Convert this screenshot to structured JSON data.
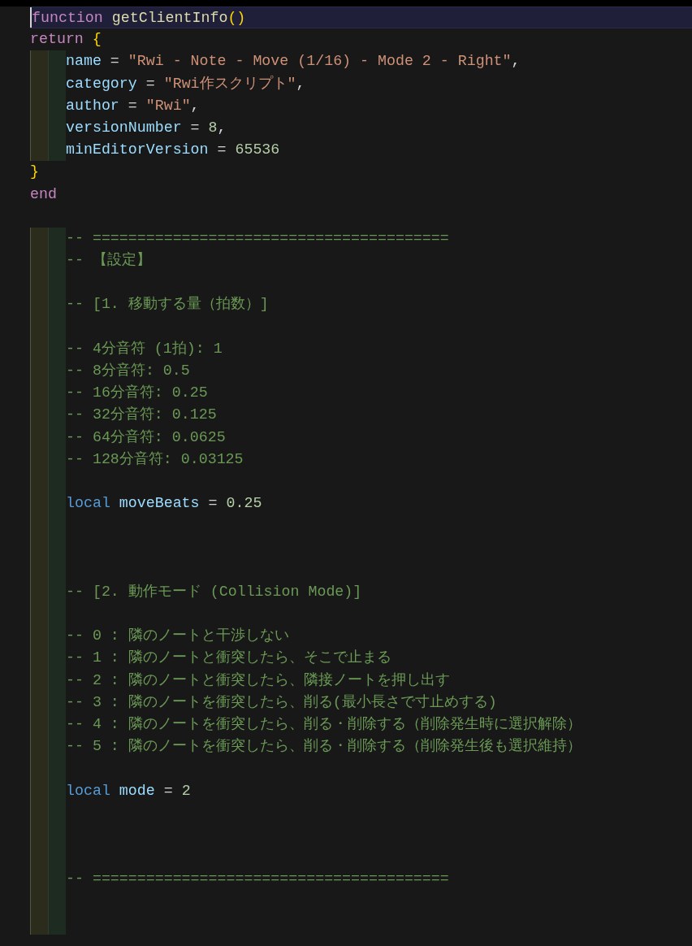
{
  "lines": [
    {
      "guides": false,
      "current": true,
      "tokens": [
        {
          "kind": "keyword",
          "text": "function "
        },
        {
          "kind": "function",
          "text": "getClientInfo"
        },
        {
          "kind": "brace",
          "text": "()"
        }
      ]
    },
    {
      "guides": false,
      "current": false,
      "tokens": [
        {
          "kind": "keyword",
          "text": "return "
        },
        {
          "kind": "brace",
          "text": "{"
        }
      ]
    },
    {
      "guides": true,
      "current": false,
      "tokens": [
        {
          "kind": "property",
          "text": "name "
        },
        {
          "kind": "operator",
          "text": "= "
        },
        {
          "kind": "string",
          "text": "\"Rwi - Note - Move (1/16) - Mode 2 - Right\""
        },
        {
          "kind": "operator",
          "text": ","
        }
      ]
    },
    {
      "guides": true,
      "current": false,
      "tokens": [
        {
          "kind": "property",
          "text": "category "
        },
        {
          "kind": "operator",
          "text": "= "
        },
        {
          "kind": "string",
          "text": "\"Rwi作スクリプト\""
        },
        {
          "kind": "operator",
          "text": ","
        }
      ]
    },
    {
      "guides": true,
      "current": false,
      "tokens": [
        {
          "kind": "property",
          "text": "author "
        },
        {
          "kind": "operator",
          "text": "= "
        },
        {
          "kind": "string",
          "text": "\"Rwi\""
        },
        {
          "kind": "operator",
          "text": ","
        }
      ]
    },
    {
      "guides": true,
      "current": false,
      "tokens": [
        {
          "kind": "property",
          "text": "versionNumber "
        },
        {
          "kind": "operator",
          "text": "= "
        },
        {
          "kind": "number",
          "text": "8"
        },
        {
          "kind": "operator",
          "text": ","
        }
      ]
    },
    {
      "guides": true,
      "current": false,
      "tokens": [
        {
          "kind": "property",
          "text": "minEditorVersion "
        },
        {
          "kind": "operator",
          "text": "= "
        },
        {
          "kind": "number",
          "text": "65536"
        }
      ]
    },
    {
      "guides": false,
      "current": false,
      "tokens": [
        {
          "kind": "brace",
          "text": "}"
        }
      ]
    },
    {
      "guides": false,
      "current": false,
      "tokens": [
        {
          "kind": "keyword",
          "text": "end"
        }
      ]
    },
    {
      "guides": false,
      "current": false
    },
    {
      "guides": true,
      "current": false,
      "tokens": [
        {
          "kind": "comment",
          "text": "-- ========================================"
        }
      ]
    },
    {
      "guides": true,
      "current": false,
      "tokens": [
        {
          "kind": "comment",
          "text": "-- 【設定】"
        }
      ]
    },
    {
      "guides": true,
      "current": false
    },
    {
      "guides": true,
      "current": false,
      "tokens": [
        {
          "kind": "comment",
          "text": "-- [1. 移動する量（拍数）]"
        }
      ]
    },
    {
      "guides": true,
      "current": false
    },
    {
      "guides": true,
      "current": false,
      "tokens": [
        {
          "kind": "comment",
          "text": "-- 4分音符 (1拍): 1"
        }
      ]
    },
    {
      "guides": true,
      "current": false,
      "tokens": [
        {
          "kind": "comment",
          "text": "-- 8分音符: 0.5"
        }
      ]
    },
    {
      "guides": true,
      "current": false,
      "tokens": [
        {
          "kind": "comment",
          "text": "-- 16分音符: 0.25"
        }
      ]
    },
    {
      "guides": true,
      "current": false,
      "tokens": [
        {
          "kind": "comment",
          "text": "-- 32分音符: 0.125"
        }
      ]
    },
    {
      "guides": true,
      "current": false,
      "tokens": [
        {
          "kind": "comment",
          "text": "-- 64分音符: 0.0625"
        }
      ]
    },
    {
      "guides": true,
      "current": false,
      "tokens": [
        {
          "kind": "comment",
          "text": "-- 128分音符: 0.03125"
        }
      ]
    },
    {
      "guides": true,
      "current": false
    },
    {
      "guides": true,
      "current": false,
      "tokens": [
        {
          "kind": "local",
          "text": "local "
        },
        {
          "kind": "property",
          "text": "moveBeats "
        },
        {
          "kind": "operator",
          "text": "= "
        },
        {
          "kind": "number",
          "text": "0.25"
        }
      ]
    },
    {
      "guides": true,
      "current": false
    },
    {
      "guides": true,
      "current": false
    },
    {
      "guides": true,
      "current": false
    },
    {
      "guides": true,
      "current": false,
      "tokens": [
        {
          "kind": "comment",
          "text": "-- [2. 動作モード (Collision Mode)]"
        }
      ]
    },
    {
      "guides": true,
      "current": false
    },
    {
      "guides": true,
      "current": false,
      "tokens": [
        {
          "kind": "comment",
          "text": "-- 0 : 隣のノートと干渉しない"
        }
      ]
    },
    {
      "guides": true,
      "current": false,
      "tokens": [
        {
          "kind": "comment",
          "text": "-- 1 : 隣のノートと衝突したら、そこで止まる"
        }
      ]
    },
    {
      "guides": true,
      "current": false,
      "tokens": [
        {
          "kind": "comment",
          "text": "-- 2 : 隣のノートと衝突したら、隣接ノートを押し出す"
        }
      ]
    },
    {
      "guides": true,
      "current": false,
      "tokens": [
        {
          "kind": "comment",
          "text": "-- 3 : 隣のノートを衝突したら、削る(最小長さで寸止めする)"
        }
      ]
    },
    {
      "guides": true,
      "current": false,
      "tokens": [
        {
          "kind": "comment",
          "text": "-- 4 : 隣のノートを衝突したら、削る・削除する（削除発生時に選択解除）"
        }
      ]
    },
    {
      "guides": true,
      "current": false,
      "tokens": [
        {
          "kind": "comment",
          "text": "-- 5 : 隣のノートを衝突したら、削る・削除する（削除発生後も選択維持）"
        }
      ]
    },
    {
      "guides": true,
      "current": false
    },
    {
      "guides": true,
      "current": false,
      "tokens": [
        {
          "kind": "local",
          "text": "local "
        },
        {
          "kind": "property",
          "text": "mode "
        },
        {
          "kind": "operator",
          "text": "= "
        },
        {
          "kind": "number",
          "text": "2"
        }
      ]
    },
    {
      "guides": true,
      "current": false
    },
    {
      "guides": true,
      "current": false
    },
    {
      "guides": true,
      "current": false
    },
    {
      "guides": true,
      "current": false,
      "tokens": [
        {
          "kind": "comment",
          "text": "-- ========================================"
        }
      ]
    },
    {
      "guides": true,
      "current": false
    },
    {
      "guides": true,
      "current": false
    }
  ]
}
